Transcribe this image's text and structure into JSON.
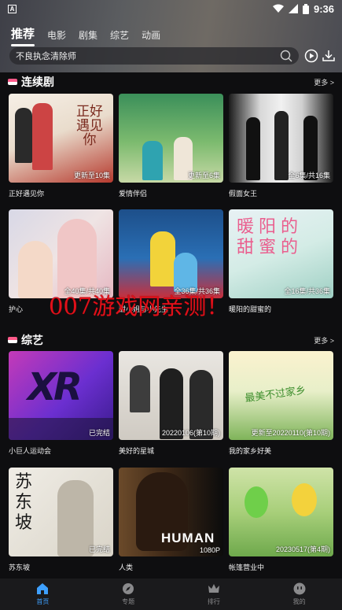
{
  "status_bar": {
    "notification_letter": "A",
    "time": "9:36"
  },
  "top_tabs": [
    "推荐",
    "电影",
    "剧集",
    "综艺",
    "动画"
  ],
  "search": {
    "placeholder": "不良执念清除师"
  },
  "sections": [
    {
      "title": "连续剧",
      "more": "更多 >",
      "items": [
        {
          "title": "正好遇见你",
          "badge": "更新至10集",
          "poster_text": "正好遇见你"
        },
        {
          "title": "爱情伴侣",
          "badge": "更新至6集",
          "poster_text": ""
        },
        {
          "title": "假面女王",
          "badge": "全6集/共16集",
          "poster_text": ""
        },
        {
          "title": "护心",
          "badge": "全40集/共40集",
          "poster_text": ""
        },
        {
          "title": "甜小姐与小先生",
          "badge": "全36集/共36集",
          "poster_text": ""
        },
        {
          "title": "暖阳的甜蜜的",
          "badge": "全16集/共36集",
          "poster_text": "暖阳的甜蜜的"
        }
      ]
    },
    {
      "title": "综艺",
      "more": "更多 >",
      "items": [
        {
          "title": "小巨人运动会",
          "badge": "已完结",
          "poster_text": "XR"
        },
        {
          "title": "美好的星城",
          "badge": "20220106(第10期)",
          "poster_text": ""
        },
        {
          "title": "我的家乡好美",
          "badge": "更新至20220110(第10期)",
          "poster_text": "最美不过家乡"
        },
        {
          "title": "苏东坡",
          "badge": "已完结",
          "poster_text": "苏东坡"
        },
        {
          "title": "人类",
          "badge": "1080P",
          "poster_text": "HUMAN"
        },
        {
          "title": "帐篷营业中",
          "badge": "20230517(第4期)",
          "poster_text": ""
        }
      ]
    }
  ],
  "watermark": "007游戏网亲测！",
  "bottom_nav": [
    {
      "label": "首页",
      "icon": "home-icon",
      "active": true
    },
    {
      "label": "专题",
      "icon": "compass-icon",
      "active": false
    },
    {
      "label": "排行",
      "icon": "crown-icon",
      "active": false
    },
    {
      "label": "我的",
      "icon": "face-icon",
      "active": false
    }
  ],
  "colors": {
    "accent": "#3ea0ff",
    "background": "#0e0e10",
    "watermark": "#e0101a"
  }
}
